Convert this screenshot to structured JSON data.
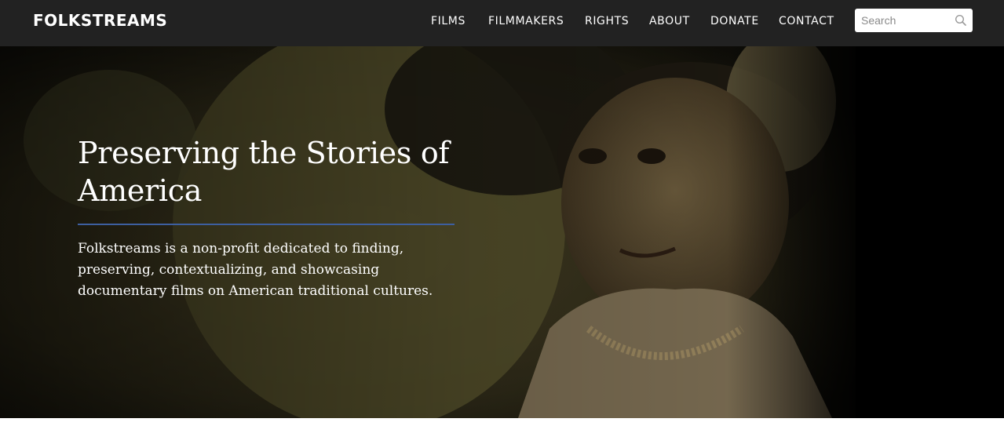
{
  "header": {
    "logo_text": "FOLKSTREAMS",
    "nav": [
      "FILMS",
      "FILMMAKERS",
      "RIGHTS",
      "ABOUT",
      "DONATE",
      "CONTACT"
    ],
    "search": {
      "placeholder": "Search",
      "icon": "search-icon"
    }
  },
  "hero": {
    "title": "Preserving the Stories of America",
    "description": "Folkstreams is a non-profit dedicated to finding, preserving, contextualizing, and showcasing documentary films on American traditional cultures."
  },
  "colors": {
    "header_bg": "#222222",
    "accent_rule": "#3d5fa0"
  }
}
